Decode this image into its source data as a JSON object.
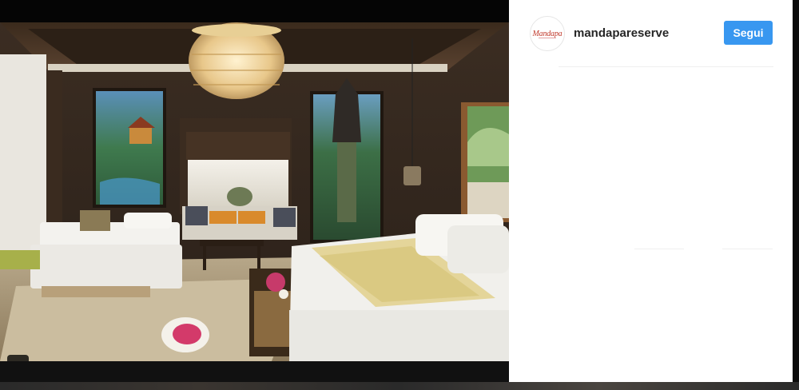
{
  "post": {
    "username": "mandapareserve",
    "avatar": {
      "logo_text": "Mandapa"
    },
    "follow_label": "Segui",
    "colors": {
      "follow_button": "#3897f0",
      "username": "#262626",
      "logo": "#c0392b"
    }
  },
  "photo": {
    "icons": [
      "user-tag-icon"
    ]
  }
}
